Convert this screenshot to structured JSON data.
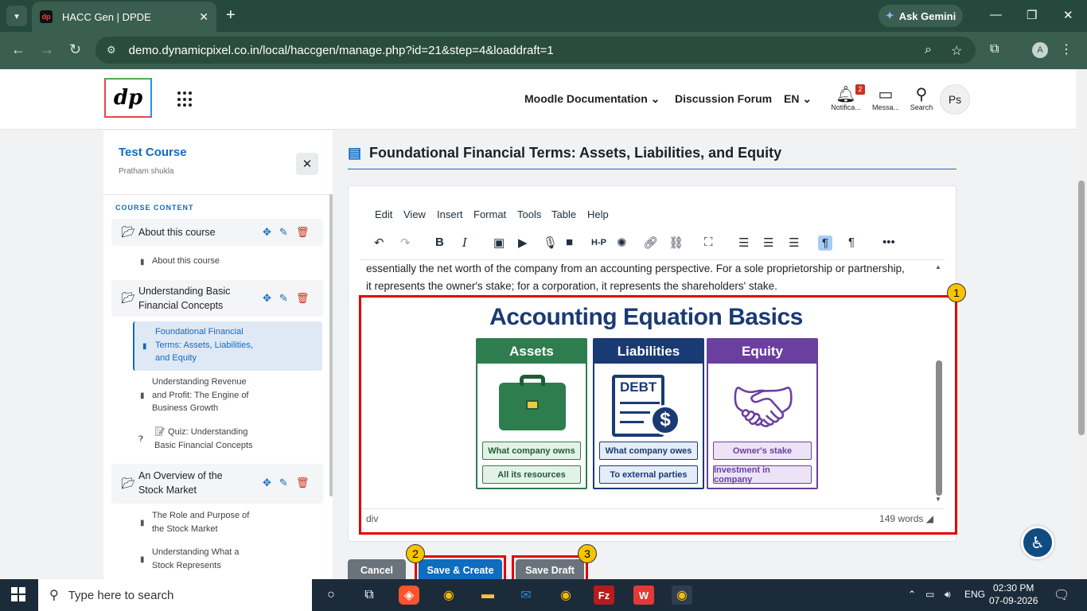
{
  "browser": {
    "tab_title": "HACC Gen | DPDE",
    "favicon_text": "dp",
    "url": "demo.dynamicpixel.co.in/local/haccgen/manage.php?id=21&step=4&loaddraft=1",
    "gemini_label": "Ask Gemini",
    "profile_initial": "A"
  },
  "header": {
    "logo_text": "dp",
    "nav": [
      {
        "label": "Moodle Documentation"
      },
      {
        "label": "Discussion Forum"
      },
      {
        "label": "EN"
      }
    ],
    "notifications_label": "Notifica...",
    "notifications_count": "2",
    "messages_label": "Messa...",
    "search_label": "Search",
    "user_initials": "Ps"
  },
  "sidebar": {
    "course_title": "Test Course",
    "author": "Pratham shukla",
    "section_heading": "COURSE CONTENT",
    "sections": [
      {
        "label": "About this course",
        "activities": [
          {
            "label": "About this course"
          }
        ]
      },
      {
        "label": "Understanding Basic Financial Concepts",
        "activities": [
          {
            "label": "Foundational Financial Terms: Assets, Liabilities, and Equity"
          },
          {
            "label": "Understanding Revenue and Profit: The Engine of Business Growth"
          },
          {
            "label": "Quiz: Understanding Basic Financial Concepts"
          }
        ]
      },
      {
        "label": "An Overview of the Stock Market",
        "activities": [
          {
            "label": "The Role and Purpose of the Stock Market"
          },
          {
            "label": "Understanding What a Stock Represents"
          }
        ]
      }
    ]
  },
  "main": {
    "page_title": "Foundational Financial Terms: Assets, Liabilities, and Equity",
    "menubar": [
      "Edit",
      "View",
      "Insert",
      "Format",
      "Tools",
      "Table",
      "Help"
    ],
    "content_text": "essentially the net worth of the company from an accounting perspective. For a sole proprietorship or partnership, it represents the owner's stake; for a corporation, it represents the shareholders' stake.",
    "status_path": "div",
    "word_count": "149 words",
    "infographic": {
      "title": "Accounting Equation Basics",
      "columns": [
        {
          "heading": "Assets",
          "items": [
            "What company owns",
            "All its resources"
          ],
          "color": "#2e7d4f"
        },
        {
          "heading": "Liabilities",
          "items": [
            "What company owes",
            "To external parties"
          ],
          "color": "#1a3a73"
        },
        {
          "heading": "Equity",
          "items": [
            "Owner's stake",
            "Investment in company"
          ],
          "color": "#6b3fa0"
        }
      ],
      "debt_label": "DEBT"
    },
    "callouts": [
      "1",
      "2",
      "3"
    ],
    "buttons": {
      "cancel": "Cancel",
      "save_create": "Save & Create",
      "save_draft": "Save Draft"
    }
  },
  "taskbar": {
    "search_placeholder": "Type here to search",
    "lang": "ENG",
    "time": "02:30 PM",
    "date": "07-09-2026"
  },
  "colors": {
    "accent": "#0f6cbf",
    "highlight": "#e10000",
    "callout": "#f6c400"
  }
}
